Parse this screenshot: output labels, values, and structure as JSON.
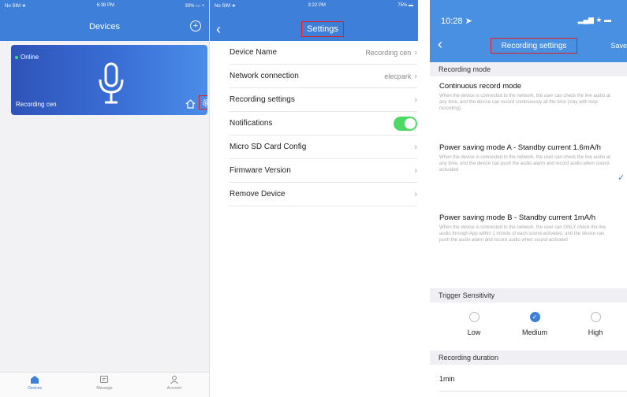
{
  "devices_screen": {
    "status_bar": {
      "carrier": "No SIM ★",
      "time": "6:38 PM",
      "battery": "30% ▭ +"
    },
    "title": "Devices",
    "add_icon": "plus-circle-icon",
    "device": {
      "status": "Online",
      "name": "Recording cen"
    },
    "tabs": [
      {
        "label": "Devices",
        "icon": "home-icon"
      },
      {
        "label": "Message",
        "icon": "message-icon"
      },
      {
        "label": "Account",
        "icon": "user-icon"
      }
    ]
  },
  "settings_screen": {
    "status_bar": {
      "carrier": "No SIM ★",
      "time": "3:22 PM",
      "battery": "75% ▬"
    },
    "title": "Settings",
    "rows": [
      {
        "label": "Device Name",
        "value": "Recording cen"
      },
      {
        "label": "Network connection",
        "value": "elecpark"
      },
      {
        "label": "Recording settings",
        "value": ""
      },
      {
        "label": "Notifications",
        "value": "",
        "toggle": true
      },
      {
        "label": "Micro SD Card Config",
        "value": ""
      },
      {
        "label": "Firmware Version",
        "value": ""
      },
      {
        "label": "Remove Device",
        "value": ""
      }
    ]
  },
  "recording_screen": {
    "time": "10:28 ➤",
    "signal": "▂▄▆ ★ ▬",
    "title": "Recording settings",
    "save_label": "Save",
    "mode_section": "Recording mode",
    "modes": [
      {
        "title": "Continuous record mode",
        "desc": "When the device is connected to the network, the user can check the live audio at any time, and the device can record continuously all the time (stay with loop recording)."
      },
      {
        "title": "Power saving mode A - Standby current 1.6mA/h",
        "desc": "When the device is connected to the network, the user can check the live audio at any time, and the device can push the audio alarm and record audio when sound-activated"
      },
      {
        "title": "Power saving mode B - Standby current 1mA/h",
        "desc": "When the device is connected to the network, the user can ONLY check the live audio through App within 1 minute of each sound-activated, and the device can push the audio alarm and record audio when sound-activated"
      }
    ],
    "sensitivity_section": "Trigger Sensitivity",
    "sensitivity": [
      {
        "label": "Low",
        "selected": false
      },
      {
        "label": "Medium",
        "selected": true
      },
      {
        "label": "High",
        "selected": false
      }
    ],
    "duration_section": "Recording duration",
    "duration_value": "1min"
  },
  "colors": {
    "primary": "#3d7fd9",
    "highlight": "#e02020",
    "toggle_on": "#4cd964"
  }
}
